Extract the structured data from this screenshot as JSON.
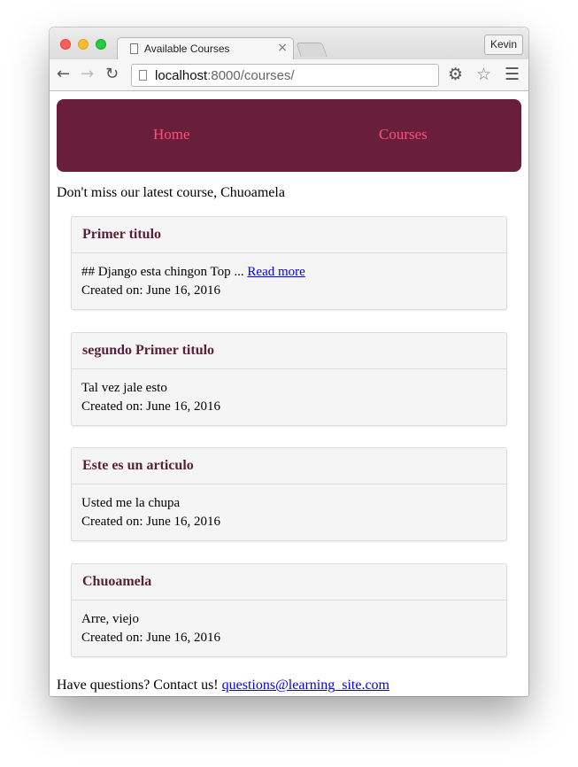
{
  "browser": {
    "tab_title": "Available Courses",
    "tab_close": "×",
    "profile_name": "Kevin",
    "url_host": "localhost",
    "url_path": ":8000/courses/",
    "icons": [
      "back-icon",
      "forward-icon",
      "reload-icon",
      "page-icon",
      "gear-icon",
      "star-icon",
      "menu-icon"
    ]
  },
  "nav": {
    "home": "Home",
    "courses": "Courses",
    "colors": {
      "banner": "#691f3a",
      "link": "#ff4f7b"
    }
  },
  "promo": "Don't miss our latest course, Chuoamela",
  "courses": [
    {
      "title": "Primer titulo",
      "body": "## Django esta chingon Top ... ",
      "read_more": "Read more",
      "created": "Created on: June 16, 2016"
    },
    {
      "title": "segundo Primer titulo",
      "body": "Tal vez jale esto",
      "created": "Created on: June 16, 2016"
    },
    {
      "title": "Este es un articulo",
      "body": "Usted me la chupa",
      "created": "Created on: June 16, 2016"
    },
    {
      "title": "Chuoamela",
      "body": "Arre, viejo",
      "created": "Created on: June 16, 2016"
    }
  ],
  "footer": {
    "text": "Have questions? Contact us! ",
    "email": "questions@learning_site.com"
  }
}
